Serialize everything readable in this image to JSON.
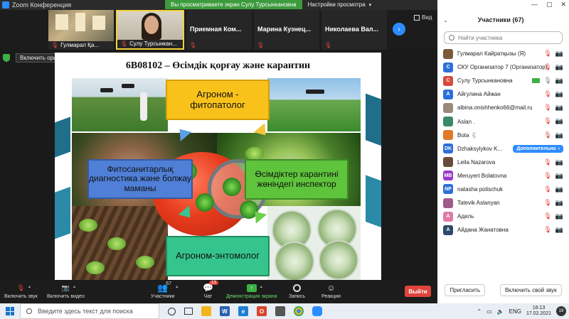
{
  "window": {
    "title": "Zoom Конференция",
    "win_min": "—",
    "win_max": "▢",
    "win_close": "✕"
  },
  "banner": {
    "message": "Вы просматриваете экран Сулу Турсынкановна",
    "options": "Настройки просмотра",
    "caret": "▾"
  },
  "strip": {
    "tiles": [
      {
        "name": "Гулмарал Қа..."
      },
      {
        "name": "Сулу Турсынкан..."
      },
      {
        "name": "Приемная  Ком..."
      },
      {
        "name": "Марина  Кузнец..."
      },
      {
        "name": "Николаева  Вал..."
      }
    ],
    "next_icon": "›",
    "view_label": "Вид"
  },
  "original_sound": {
    "label": "Включить оригинальный звук",
    "caret": "▾"
  },
  "slide": {
    "title": "6В08102 – Өсімдік қорғау және карантин",
    "boxes": {
      "top": "Агроном -\nфитопатолог",
      "left": "Фитосанитарлық диагностика және болжау маманы",
      "right": "Өсімдіктер карантині жөніндегі инспектор",
      "bottom": "Агроном-энтомолог"
    }
  },
  "participants": {
    "title": "Участники (67)",
    "collapse_icon": "⌄",
    "search_placeholder": "Найти участника",
    "list": [
      {
        "name": "Гулмарал Кайратқызы (Я)",
        "initials": "",
        "color": "#7a5a3a",
        "cam": "off"
      },
      {
        "name": "СКУ Организатор 7 (Организатор)",
        "initials": "С",
        "color": "#2d6fd8",
        "cam": "off"
      },
      {
        "name": "Сулу Турсынкановна",
        "initials": "С",
        "color": "#d84a3a",
        "cam": "on"
      },
      {
        "name": "Айгулина Айжан",
        "initials": "А",
        "color": "#2d6fd8",
        "cam": "off"
      },
      {
        "name": "albina.onishhenko66@mail.ru",
        "initials": "",
        "color": "#9a8a7a",
        "cam": "off"
      },
      {
        "name": "Aslan .",
        "initials": "",
        "color": "#3a8a6a",
        "cam": "off"
      },
      {
        "name": "Bota 🐇",
        "initials": "",
        "color": "#e07a2a",
        "cam": "off"
      },
      {
        "name": "Dzhaksylykov K...",
        "initials": "DK",
        "color": "#2d6fd8",
        "cam": "more"
      },
      {
        "name": "Leila Nazarova",
        "initials": "",
        "color": "#6a4a3a",
        "cam": "off"
      },
      {
        "name": "Meruyert Bolatovna",
        "initials": "MB",
        "color": "#9a3ac8",
        "cam": "off"
      },
      {
        "name": "natasha polischuk",
        "initials": "NP",
        "color": "#2d6fd8",
        "cam": "off"
      },
      {
        "name": "Tatevik Aslanyan",
        "initials": "",
        "color": "#a05a8a",
        "cam": "off"
      },
      {
        "name": "Адиль",
        "initials": "А",
        "color": "#e07aa8",
        "cam": "off"
      },
      {
        "name": "Айдана Жанатовна",
        "initials": "А",
        "color": "#2d4a6a",
        "cam": "off"
      }
    ],
    "more_label": "Дополнительно",
    "more_caret": "›",
    "invite": "Пригласить",
    "unmute_self": "Включить свой звук"
  },
  "icons": {
    "mic_off": "🎙",
    "cam_off": "📷",
    "mic": "🎙",
    "caret": "▴"
  },
  "toolbar": {
    "unmute": "Включить звук",
    "start_video": "Включить видео",
    "participants": "Участники",
    "participants_count": "67",
    "chat": "Чат",
    "chat_badge": "13",
    "share": "Демонстрация экрана",
    "record": "Запись",
    "reactions": "Реакции",
    "leave": "Выйти"
  },
  "taskbar": {
    "search_placeholder": "Введите здесь текст для поиска",
    "lang": "ENG",
    "time": "16:13",
    "date": "17.02.2021",
    "notif_count": "19"
  }
}
